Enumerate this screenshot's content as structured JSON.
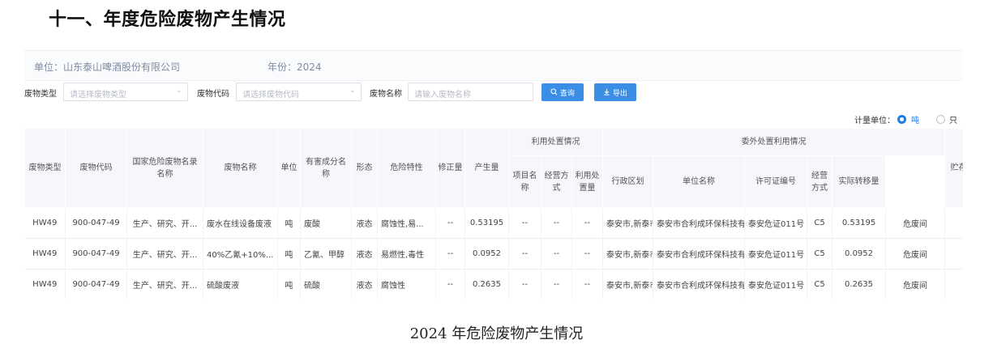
{
  "heading": "十一、年度危险废物产生情况",
  "info": {
    "unit_text": "单位：山东泰山啤酒股份有限公司",
    "year_text": "年份：2024"
  },
  "filters": {
    "type_label": "废物类型",
    "type_placeholder": "请选择废物类型",
    "code_label": "废物代码",
    "code_placeholder": "请选择废物代码",
    "name_label": "废物名称",
    "name_placeholder": "请输入废物名称",
    "query_label": "查询",
    "export_label": "导出",
    "chevron_icon": "chevron-down-icon",
    "search_icon": "search-icon",
    "download_icon": "download-icon"
  },
  "measure": {
    "label": "计量单位：",
    "option_ton": "吨",
    "option_piece": "只",
    "selected": "吨",
    "accent_color": "#1f7cf0"
  },
  "table": {
    "headers": {
      "waste_type": "废物类型",
      "waste_code": "废物代码",
      "national_list": "国家危险废物名录名称",
      "waste_name": "废物名称",
      "unit": "单位",
      "harmful": "有害成分名称",
      "form": "形态",
      "hazard": "危险特性",
      "corrected": "修正量",
      "produced": "产生量",
      "group_self": "利用处置情况",
      "self_project": "项目名称",
      "self_mode": "经营方式",
      "self_amount": "利用处置量",
      "group_outsource": "委外处置利用情况",
      "out_region": "行政区划",
      "out_org": "单位名称",
      "out_license": "许可证编号",
      "out_mode": "经营方式",
      "out_amount": "实际转移量",
      "storage": "贮存设施"
    },
    "rows": [
      {
        "waste_type": "HW49",
        "waste_code": "900-047-49",
        "national_list": "生产、研究、开...",
        "waste_name": "废水在线设备废液",
        "unit": "吨",
        "harmful": "废酸",
        "form": "液态",
        "hazard": "腐蚀性,易...",
        "corrected": "--",
        "produced": "0.53195",
        "self_project": "--",
        "self_mode": "--",
        "self_amount": "--",
        "out_region": "泰安市,新泰市",
        "out_org": "泰安市合利成环保科技有限公司",
        "out_license": "泰安危证011号",
        "out_mode": "C5",
        "out_amount": "0.53195",
        "storage": "危废间"
      },
      {
        "waste_type": "HW49",
        "waste_code": "900-047-49",
        "national_list": "生产、研究、开...",
        "waste_name": "40%乙氰+10%...",
        "unit": "吨",
        "harmful": "乙氰、甲醇",
        "form": "液态",
        "hazard": "易燃性,毒性",
        "corrected": "--",
        "produced": "0.0952",
        "self_project": "--",
        "self_mode": "--",
        "self_amount": "--",
        "out_region": "泰安市,新泰市",
        "out_org": "泰安市合利成环保科技有限公司",
        "out_license": "泰安危证011号",
        "out_mode": "C5",
        "out_amount": "0.0952",
        "storage": "危废间"
      },
      {
        "waste_type": "HW49",
        "waste_code": "900-047-49",
        "national_list": "生产、研究、开...",
        "waste_name": "硫酸废液",
        "unit": "吨",
        "harmful": "硫酸",
        "form": "液态",
        "hazard": "腐蚀性",
        "corrected": "--",
        "produced": "0.2635",
        "self_project": "--",
        "self_mode": "--",
        "self_amount": "--",
        "out_region": "泰安市,新泰市",
        "out_org": "泰安市合利成环保科技有限公司",
        "out_license": "泰安危证011号",
        "out_mode": "C5",
        "out_amount": "0.2635",
        "storage": "危废间"
      }
    ]
  },
  "caption": "2024 年危险废物产生情况"
}
